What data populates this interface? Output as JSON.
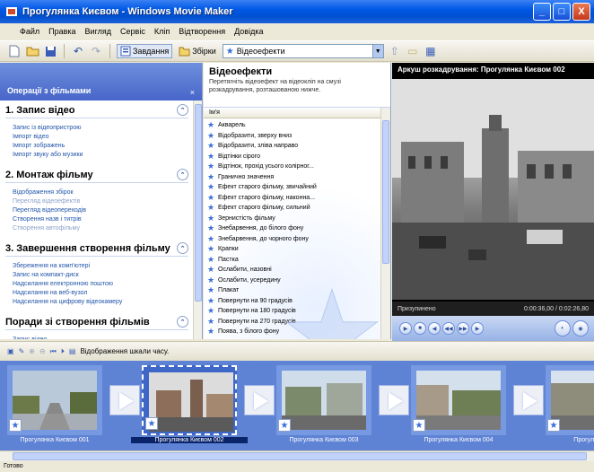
{
  "window": {
    "title": "Прогулянка Києвом - Windows Movie Maker",
    "buttons": [
      "_",
      "□",
      "X"
    ]
  },
  "menu": [
    "Файл",
    "Правка",
    "Вигляд",
    "Сервіс",
    "Кліп",
    "Відтворення",
    "Довідка"
  ],
  "toolbar": {
    "icons": [
      "new-icon",
      "open-icon",
      "save-icon",
      "undo-icon",
      "redo-icon"
    ],
    "undo_glyph": "↶",
    "redo_glyph": "↷",
    "tasks_label": "Завдання",
    "collections_label": "Збірки",
    "collection_select": "Відеоефекти"
  },
  "tasks": {
    "header": "Операції з фільмами",
    "close": "×",
    "groups": [
      {
        "title": "1. Запис відео",
        "links": [
          {
            "text": "Запис із відеопристрою",
            "dim": false
          },
          {
            "text": "Імпорт відео",
            "dim": false
          },
          {
            "text": "Імпорт зображень",
            "dim": false
          },
          {
            "text": "Імпорт звуку або музики",
            "dim": false
          }
        ]
      },
      {
        "title": "2. Монтаж фільму",
        "links": [
          {
            "text": "Відображення збірок",
            "dim": false
          },
          {
            "text": "Перегляд відеоефектів",
            "dim": true
          },
          {
            "text": "Перегляд відеопереходів",
            "dim": false
          },
          {
            "text": "Створення назв і титрів",
            "dim": false
          },
          {
            "text": "Створення автофільму",
            "dim": true
          }
        ]
      },
      {
        "title": "3. Завершення створення фільму",
        "links": [
          {
            "text": "Збереження на комп'ютері",
            "dim": false
          },
          {
            "text": "Запис на компакт-диск",
            "dim": false
          },
          {
            "text": "Надсилання електронною поштою",
            "dim": false
          },
          {
            "text": "Надсилання на веб-вузол",
            "dim": false
          },
          {
            "text": "Надсилання на цифрову відеокамеру",
            "dim": false
          }
        ]
      },
      {
        "title": "Поради зі створення фільмів",
        "links": [
          {
            "text": "Запис відео",
            "dim": false
          }
        ]
      }
    ]
  },
  "effects": {
    "title": "Відеоефекти",
    "description": "Перетягніть відеоефект на відеокліп на смузі розкадрування, розташованою нижче.",
    "column": "Ім'я",
    "items": [
      "Акварель",
      "Відобразити, зверху вниз",
      "Відобразити, зліва направо",
      "Відтінки сірого",
      "Відтінок, прохід усього колірног...",
      "Гранично значення",
      "Ефект старого фільму, звичайний",
      "Ефект старого фільму, наконна...",
      "Ефект старого фільму, сильний",
      "Зернистість фільму",
      "Знебарвення, до білого фону",
      "Знебарвення, до чорного фону",
      "Крапки",
      "Пастка",
      "Ослабити, назовні",
      "Ослабити, усередину",
      "Плакат",
      "Повернути на 90 градусів",
      "Повернути на 180 градусів",
      "Повернути на 270 градусів",
      "Поява, з білого фону",
      "Поява, з чорного фону"
    ]
  },
  "monitor": {
    "title": "Аркуш розкадрування: Прогулянка Києвом 002",
    "status": "Призупинено",
    "time": "0:00:36,00 / 0:02:26,80",
    "progress": 0.25
  },
  "storyboard_toolbar": {
    "label": "Відображення шкали часу."
  },
  "storyboard": {
    "clips": [
      {
        "label": "Прогулянка Києвом 001",
        "selected": false
      },
      {
        "label": "Прогулянка Києвом 002",
        "selected": true
      },
      {
        "label": "Прогулянка Києвом 003",
        "selected": false
      },
      {
        "label": "Прогулянка Києвом 004",
        "selected": false
      },
      {
        "label": "Прогулянка...",
        "selected": false
      }
    ]
  },
  "status_bar": "Готово",
  "colors": {
    "titlebar": "#0058E6",
    "storyboard_bg": "#5E82D4",
    "accent": "#3A6EDB"
  }
}
